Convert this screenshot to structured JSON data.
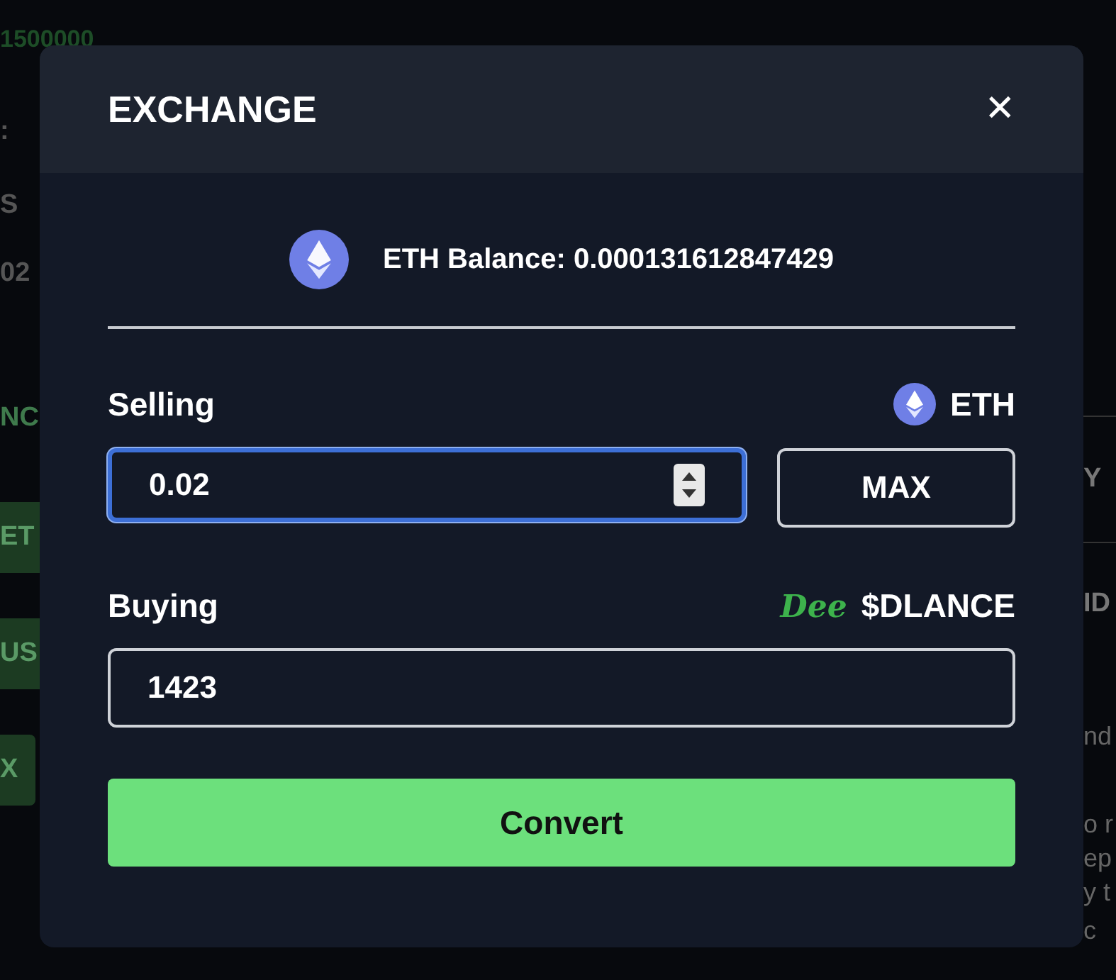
{
  "background": {
    "left": [
      {
        "text": "1500000",
        "kind": "amount"
      },
      {
        "text": ":",
        "kind": "plain"
      },
      {
        "text": "S",
        "kind": "plain"
      },
      {
        "text": "02",
        "kind": "plain"
      },
      {
        "text": "NC",
        "kind": "tab"
      },
      {
        "text": "ET",
        "kind": "button"
      },
      {
        "text": "US",
        "kind": "button"
      },
      {
        "text": "X",
        "kind": "button"
      }
    ],
    "right": [
      {
        "text": "Y",
        "kind": "heading"
      },
      {
        "text": "ID",
        "kind": "heading"
      },
      {
        "text": "nd",
        "kind": "plain"
      },
      {
        "text": "o r",
        "kind": "plain"
      },
      {
        "text": "ep",
        "kind": "plain"
      },
      {
        "text": "y t",
        "kind": "plain"
      },
      {
        "text": "c",
        "kind": "plain"
      }
    ]
  },
  "modal": {
    "title": "EXCHANGE",
    "close": "✕",
    "balance": "ETH Balance: 0.000131612847429",
    "selling": {
      "label": "Selling",
      "token": "ETH",
      "value": "0.02",
      "focused": true
    },
    "max": "MAX",
    "buying": {
      "label": "Buying",
      "token_logo": "Dee",
      "token": "$DLANCE",
      "value": "1423",
      "focused": false
    },
    "convert": "Convert"
  }
}
